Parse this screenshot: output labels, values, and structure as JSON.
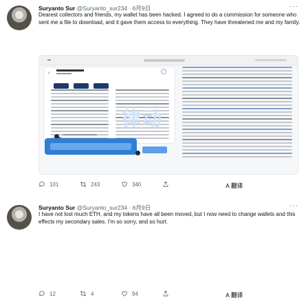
{
  "tweets": [
    {
      "name": "Suryanto Sur",
      "handle": "@Suryanto_sur234 · 6月9日",
      "more": "···",
      "text": "Dearest collectors and friends, my wallet has been hacked. I agreed to do a commission for someone who sent me a file to download, and it gave them access to everything. They have threatened me and my family.",
      "watermark": "律动",
      "actions": {
        "reply": "101",
        "retweet": "243",
        "like": "340",
        "translate": "A 翻译"
      }
    },
    {
      "name": "Suryanto Sur",
      "handle": "@Suryanto_sur234 · 6月9日",
      "more": "···",
      "text": "I have not lost much ETH, and my tokens have all been moved, but I now need to change wallets and this effects my secondary sales. I'm so sorry, and so hurt.",
      "actions": {
        "reply": "12",
        "retweet": "4",
        "like": "94",
        "translate": "A 翻译"
      }
    }
  ],
  "colors": {
    "accent": "#2f7fd6",
    "meta": "#536471"
  }
}
